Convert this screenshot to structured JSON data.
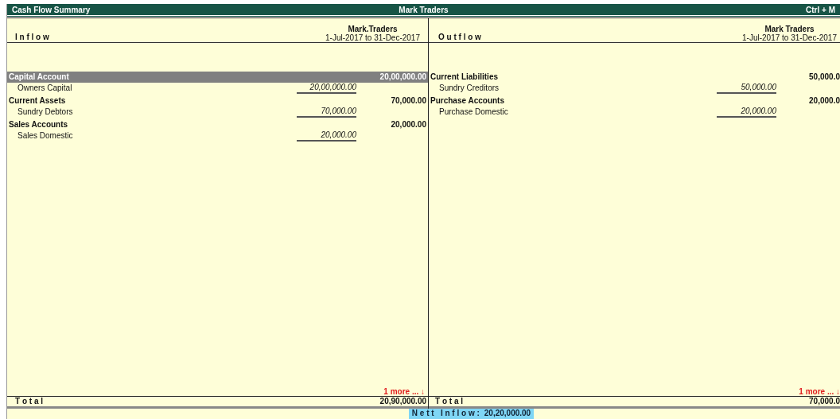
{
  "window": {
    "title": "Cash Flow Summary",
    "company": "Mark Traders",
    "shortcut": "Ctrl + M"
  },
  "panels": [
    {
      "heading": "I n f l o w",
      "company": "Mark.Traders",
      "period": "1-Jul-2017 to 31-Dec-2017",
      "groups": [
        {
          "name": "Capital Account",
          "amount": "20,00,000.00",
          "selected": true,
          "items": [
            {
              "name": "Owners Capital",
              "amount": "20,00,000.00"
            }
          ]
        },
        {
          "name": "Current Assets",
          "amount": "70,000.00",
          "selected": false,
          "items": [
            {
              "name": "Sundry Debtors",
              "amount": "70,000.00"
            }
          ]
        },
        {
          "name": "Sales Accounts",
          "amount": "20,000.00",
          "selected": false,
          "items": [
            {
              "name": "Sales Domestic",
              "amount": "20,000.00"
            }
          ]
        }
      ],
      "more": "1 more ... ↓",
      "total_label": "T o t a l",
      "total": "20,90,000.00"
    },
    {
      "heading": "O u t f l o w",
      "company": "Mark Traders",
      "period": "1-Jul-2017 to 31-Dec-2017",
      "groups": [
        {
          "name": "Current Liabilities",
          "amount": "50,000.0",
          "selected": false,
          "items": [
            {
              "name": "Sundry Creditors",
              "amount": "50,000.00"
            }
          ]
        },
        {
          "name": "Purchase Accounts",
          "amount": "20,000.0",
          "selected": false,
          "items": [
            {
              "name": "Purchase Domestic",
              "amount": "20,000.00"
            }
          ]
        }
      ],
      "more": "1 more ... ↓",
      "total_label": "T o t a l",
      "total": "70,000.0"
    }
  ],
  "nett": {
    "label": "N e t t   I n f l o w :",
    "amount": "20,20,000.00"
  }
}
